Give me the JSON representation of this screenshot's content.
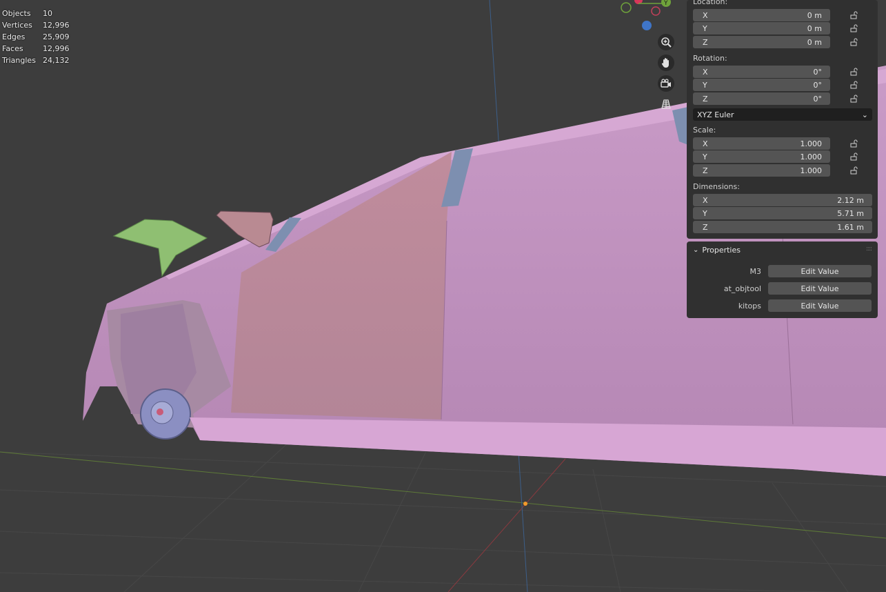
{
  "stats": [
    {
      "label": "Objects",
      "value": "10"
    },
    {
      "label": "Vertices",
      "value": "12,996"
    },
    {
      "label": "Edges",
      "value": "25,909"
    },
    {
      "label": "Faces",
      "value": "12,996"
    },
    {
      "label": "Triangles",
      "value": "24,132"
    }
  ],
  "gizmo": {
    "y_label": "Y"
  },
  "nav": {
    "zoom": "zoom-icon",
    "pan": "hand-icon",
    "camera": "camera-icon",
    "perspective": "grid-icon"
  },
  "transform": {
    "location_label": "Location:",
    "location": [
      {
        "axis": "X",
        "value": "0 m"
      },
      {
        "axis": "Y",
        "value": "0 m"
      },
      {
        "axis": "Z",
        "value": "0 m"
      }
    ],
    "rotation_label": "Rotation:",
    "rotation": [
      {
        "axis": "X",
        "value": "0°"
      },
      {
        "axis": "Y",
        "value": "0°"
      },
      {
        "axis": "Z",
        "value": "0°"
      }
    ],
    "rotation_mode": "XYZ Euler",
    "scale_label": "Scale:",
    "scale": [
      {
        "axis": "X",
        "value": "1.000"
      },
      {
        "axis": "Y",
        "value": "1.000"
      },
      {
        "axis": "Z",
        "value": "1.000"
      }
    ],
    "dimensions_label": "Dimensions:",
    "dimensions": [
      {
        "axis": "X",
        "value": "2.12 m"
      },
      {
        "axis": "Y",
        "value": "5.71 m"
      },
      {
        "axis": "Z",
        "value": "1.61 m"
      }
    ]
  },
  "properties": {
    "title": "Properties",
    "items": [
      {
        "name": "M3",
        "button": "Edit Value"
      },
      {
        "name": "at_objtool",
        "button": "Edit Value"
      },
      {
        "name": "kitops",
        "button": "Edit Value"
      }
    ]
  }
}
